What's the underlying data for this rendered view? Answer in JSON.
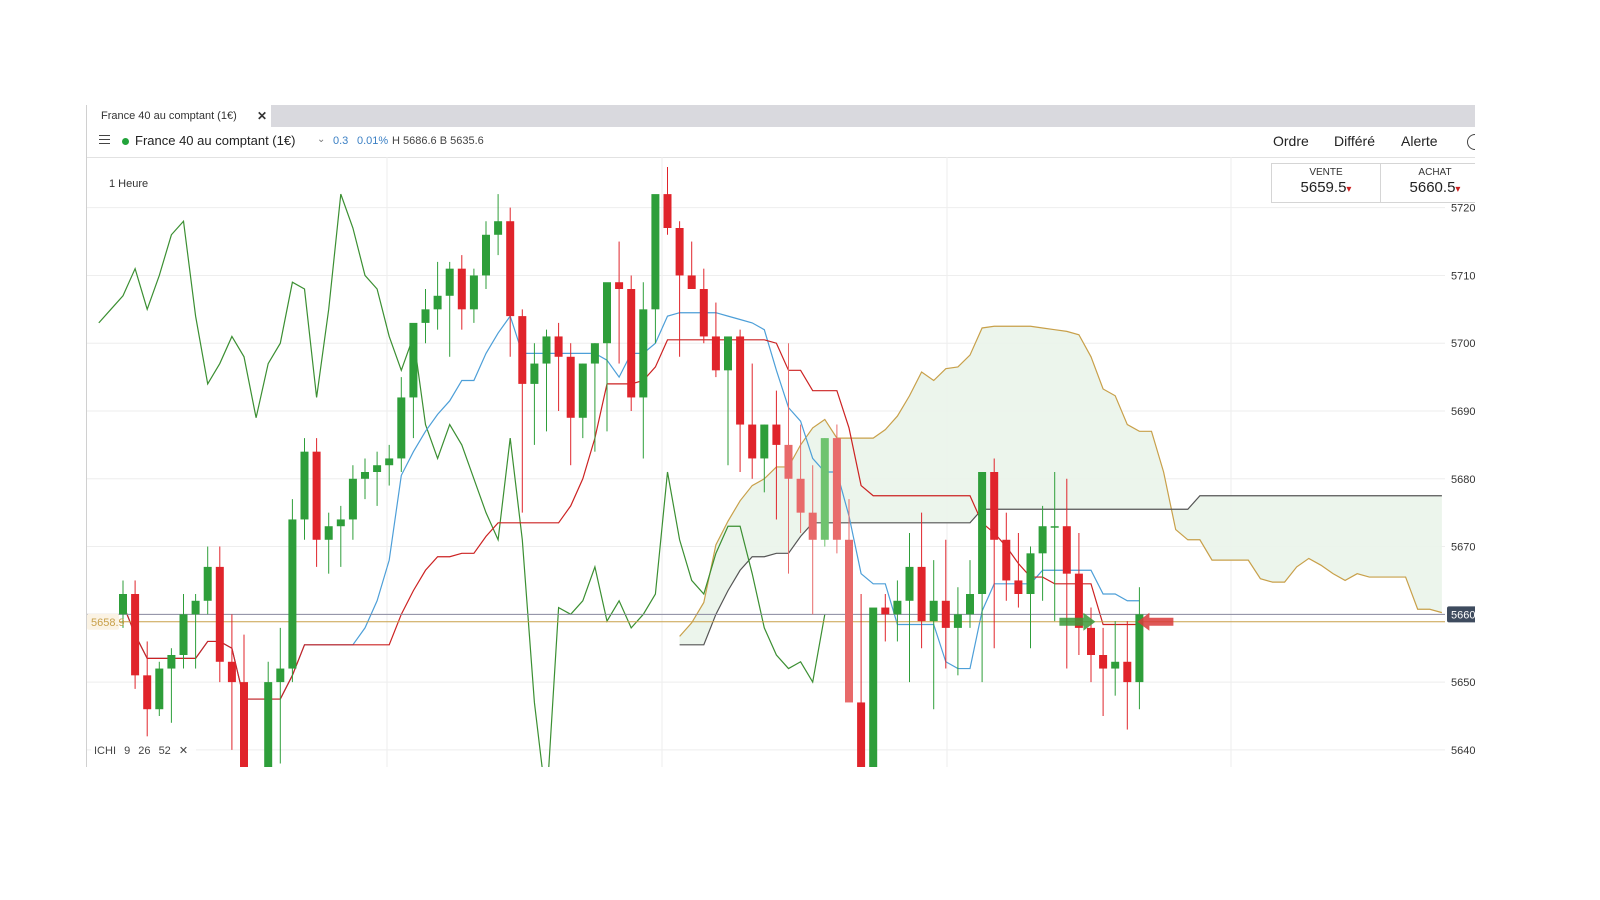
{
  "tab": {
    "label": "France 40 au comptant (1€)",
    "close": "✕"
  },
  "toolbar": {
    "instrument": "France 40 au comptant (1€)",
    "change": "0.3",
    "change_pct": "0.01%",
    "high_low": "H 5686.6 B 5635.6",
    "buttons": [
      "Ordre",
      "Différé",
      "Alerte"
    ],
    "status_color": "#22a33a"
  },
  "chart_data": {
    "type": "candlestick",
    "interval": "1 Heure",
    "ylim": [
      5636,
      5726
    ],
    "y_ticks": [
      "5720",
      "5710",
      "5700",
      "5690",
      "5680",
      "5670",
      "5660",
      "5650",
      "5640"
    ],
    "current_price_label": "5660",
    "marker_price_label": "5658.9",
    "colors": {
      "up": "#2e9e3a",
      "down": "#e0242b",
      "up_faded": "#6fc36f",
      "down_faded": "#e86a6a",
      "tenkan": "#4d9fd8",
      "kijun": "#cc2222",
      "chikou": "#3b8f32",
      "span_a": "#c8a04a",
      "span_b": "#555555",
      "cloud_bull": "#eaf4ea",
      "cloud_bear": "#fdeeee"
    },
    "candles": [
      [
        5660,
        5665,
        5658,
        5663
      ],
      [
        5663,
        5665,
        5649,
        5651
      ],
      [
        5651,
        5656,
        5642,
        5646
      ],
      [
        5646,
        5653,
        5645,
        5652
      ],
      [
        5652,
        5655,
        5644,
        5654
      ],
      [
        5654,
        5663,
        5652,
        5660
      ],
      [
        5660,
        5663,
        5652,
        5662
      ],
      [
        5662,
        5670,
        5660,
        5667
      ],
      [
        5667,
        5670,
        5650,
        5653
      ],
      [
        5653,
        5660,
        5640,
        5650
      ],
      [
        5650,
        5657,
        5625,
        5629
      ],
      [
        5629,
        5637,
        5625,
        5633
      ],
      [
        5633,
        5653,
        5630,
        5650
      ],
      [
        5650,
        5658,
        5638,
        5652
      ],
      [
        5652,
        5677,
        5650,
        5674
      ],
      [
        5674,
        5686,
        5671,
        5684
      ],
      [
        5684,
        5686,
        5667,
        5671
      ],
      [
        5671,
        5675,
        5666,
        5673
      ],
      [
        5673,
        5676,
        5667,
        5674
      ],
      [
        5674,
        5682,
        5671,
        5680
      ],
      [
        5680,
        5683,
        5677,
        5681
      ],
      [
        5681,
        5684,
        5676,
        5682
      ],
      [
        5682,
        5685,
        5679,
        5683
      ],
      [
        5683,
        5695,
        5681,
        5692
      ],
      [
        5692,
        5702,
        5686,
        5703
      ],
      [
        5703,
        5708,
        5700,
        5705
      ],
      [
        5705,
        5712,
        5702,
        5707
      ],
      [
        5707,
        5712,
        5698,
        5711
      ],
      [
        5711,
        5713,
        5702,
        5705
      ],
      [
        5705,
        5711,
        5703,
        5710
      ],
      [
        5710,
        5718,
        5708,
        5716
      ],
      [
        5716,
        5722,
        5713,
        5718
      ],
      [
        5718,
        5720,
        5698,
        5704
      ],
      [
        5704,
        5705,
        5675,
        5694
      ],
      [
        5694,
        5700,
        5685,
        5697
      ],
      [
        5697,
        5702,
        5687,
        5701
      ],
      [
        5701,
        5703,
        5690,
        5698
      ],
      [
        5698,
        5700,
        5682,
        5689
      ],
      [
        5689,
        5697,
        5686,
        5697
      ],
      [
        5697,
        5700,
        5684,
        5700
      ],
      [
        5700,
        5706,
        5687,
        5709
      ],
      [
        5709,
        5715,
        5697,
        5708
      ],
      [
        5708,
        5710,
        5690,
        5692
      ],
      [
        5692,
        5709,
        5683,
        5705
      ],
      [
        5705,
        5718,
        5700,
        5722
      ],
      [
        5722,
        5726,
        5716,
        5717
      ],
      [
        5717,
        5718,
        5698,
        5710
      ],
      [
        5710,
        5715,
        5708,
        5708
      ],
      [
        5708,
        5711,
        5700,
        5701
      ],
      [
        5701,
        5706,
        5695,
        5696
      ],
      [
        5696,
        5700,
        5682,
        5701
      ],
      [
        5701,
        5702,
        5681,
        5688
      ],
      [
        5688,
        5697,
        5680,
        5683
      ],
      [
        5683,
        5688,
        5678,
        5688
      ],
      [
        5688,
        5693,
        5674,
        5685
      ]
    ],
    "candles_late": [
      [
        5685,
        5700,
        5666,
        5680
      ],
      [
        5680,
        5688,
        5672,
        5675
      ],
      [
        5675,
        5682,
        5660,
        5671
      ],
      [
        5671,
        5686,
        5670,
        5686
      ],
      [
        5686,
        5688,
        5669,
        5671
      ],
      [
        5671,
        5677,
        5649,
        5647
      ],
      [
        5647,
        5663,
        5632,
        5632
      ],
      [
        5632,
        5658,
        5629,
        5661
      ],
      [
        5661,
        5663,
        5656,
        5660
      ],
      [
        5660,
        5665,
        5656,
        5662
      ],
      [
        5662,
        5672,
        5650,
        5667
      ],
      [
        5667,
        5675,
        5655,
        5659
      ],
      [
        5659,
        5668,
        5646,
        5662
      ],
      [
        5662,
        5671,
        5652,
        5658
      ],
      [
        5658,
        5664,
        5651,
        5660
      ],
      [
        5660,
        5668,
        5658,
        5663
      ],
      [
        5663,
        5673,
        5650,
        5681
      ],
      [
        5681,
        5683,
        5655,
        5671
      ],
      [
        5671,
        5675,
        5662,
        5665
      ],
      [
        5665,
        5672,
        5661,
        5663
      ],
      [
        5663,
        5670,
        5655,
        5669
      ],
      [
        5669,
        5676,
        5662,
        5673
      ],
      [
        5673,
        5681,
        5659,
        5673
      ],
      [
        5673,
        5680,
        5652,
        5666
      ],
      [
        5666,
        5672,
        5654,
        5658
      ],
      [
        5658,
        5661,
        5650,
        5654
      ],
      [
        5654,
        5658,
        5645,
        5652
      ],
      [
        5652,
        5659,
        5648,
        5653
      ],
      [
        5653,
        5659,
        5643,
        5650
      ],
      [
        5650,
        5664,
        5646,
        5660
      ]
    ],
    "ichimoku": {
      "label": "ICHI",
      "params": [
        "9",
        "26",
        "52"
      ]
    }
  },
  "quotes": {
    "sell": {
      "label": "VENTE",
      "value": "5659.5",
      "arrow": "▾"
    },
    "buy": {
      "label": "ACHAT",
      "value": "5660.5",
      "arrow": "▾"
    }
  },
  "legend_close": "✕"
}
